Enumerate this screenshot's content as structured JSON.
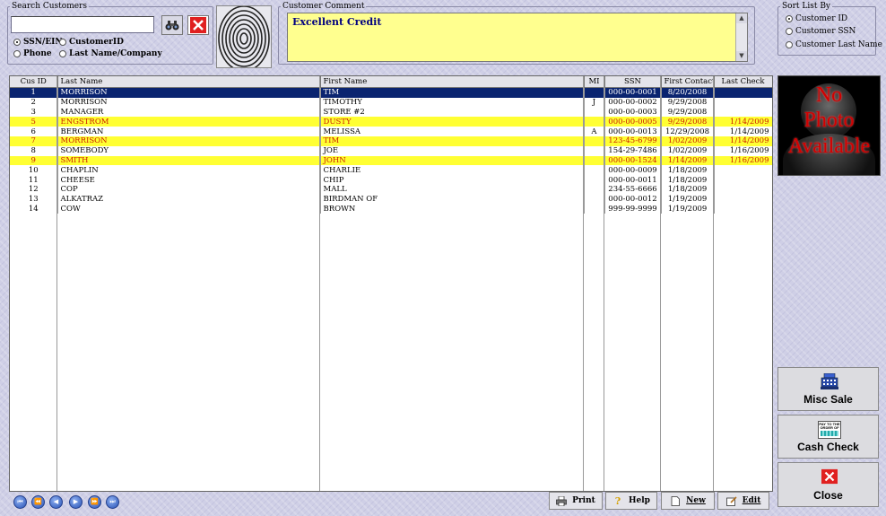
{
  "search": {
    "legend": "Search Customers",
    "value": "",
    "options": [
      {
        "label": "SSN/EIN",
        "selected": true
      },
      {
        "label": "CustomerID",
        "selected": false
      },
      {
        "label": "Phone",
        "selected": false
      },
      {
        "label": "Last Name/Company",
        "selected": false
      }
    ]
  },
  "comment": {
    "legend": "Customer Comment",
    "text": "Excellent Credit"
  },
  "sort": {
    "legend": "Sort List By",
    "options": [
      {
        "label": "Customer ID",
        "selected": true
      },
      {
        "label": "Customer SSN",
        "selected": false
      },
      {
        "label": "Customer Last Name",
        "selected": false
      }
    ]
  },
  "grid": {
    "columns": [
      "Cus ID",
      "Last Name",
      "First Name",
      "MI",
      "SSN",
      "First Contact",
      "Last Check"
    ],
    "rows": [
      {
        "id": "1",
        "last": "MORRISON",
        "first": "TIM",
        "mi": "",
        "ssn": "000-00-0001",
        "first_contact": "8/20/2008",
        "last_check": "",
        "state": "selected"
      },
      {
        "id": "2",
        "last": "MORRISON",
        "first": "TIMOTHY",
        "mi": "J",
        "ssn": "000-00-0002",
        "first_contact": "9/29/2008",
        "last_check": "",
        "state": ""
      },
      {
        "id": "3",
        "last": "MANAGER",
        "first": "STORE #2",
        "mi": "",
        "ssn": "000-00-0003",
        "first_contact": "9/29/2008",
        "last_check": "",
        "state": ""
      },
      {
        "id": "5",
        "last": "ENGSTROM",
        "first": "DUSTY",
        "mi": "",
        "ssn": "000-00-0005",
        "first_contact": "9/29/2008",
        "last_check": "1/14/2009",
        "state": "highlight"
      },
      {
        "id": "6",
        "last": "BERGMAN",
        "first": "MELISSA",
        "mi": "A",
        "ssn": "000-00-0013",
        "first_contact": "12/29/2008",
        "last_check": "1/14/2009",
        "state": ""
      },
      {
        "id": "7",
        "last": "MORRISON",
        "first": "TIM",
        "mi": "",
        "ssn": "123-45-6799",
        "first_contact": "1/02/2009",
        "last_check": "1/14/2009",
        "state": "highlight"
      },
      {
        "id": "8",
        "last": "SOMEBODY",
        "first": "JOE",
        "mi": "",
        "ssn": "154-29-7486",
        "first_contact": "1/02/2009",
        "last_check": "1/16/2009",
        "state": ""
      },
      {
        "id": "9",
        "last": "SMITH",
        "first": "JOHN",
        "mi": "",
        "ssn": "000-00-1524",
        "first_contact": "1/14/2009",
        "last_check": "1/16/2009",
        "state": "highlight"
      },
      {
        "id": "10",
        "last": "CHAPLIN",
        "first": "CHARLIE",
        "mi": "",
        "ssn": "000-00-0009",
        "first_contact": "1/18/2009",
        "last_check": "",
        "state": ""
      },
      {
        "id": "11",
        "last": "CHEESE",
        "first": "CHIP",
        "mi": "",
        "ssn": "000-00-0011",
        "first_contact": "1/18/2009",
        "last_check": "",
        "state": ""
      },
      {
        "id": "12",
        "last": "COP",
        "first": "MALL",
        "mi": "",
        "ssn": "234-55-6666",
        "first_contact": "1/18/2009",
        "last_check": "",
        "state": ""
      },
      {
        "id": "13",
        "last": "ALKATRAZ",
        "first": "BIRDMAN OF",
        "mi": "",
        "ssn": "000-00-0012",
        "first_contact": "1/19/2009",
        "last_check": "",
        "state": ""
      },
      {
        "id": "14",
        "last": "COW",
        "first": "BROWN",
        "mi": "",
        "ssn": "999-99-9999",
        "first_contact": "1/19/2009",
        "last_check": "",
        "state": ""
      }
    ]
  },
  "photo": {
    "lines": [
      "No",
      "Photo",
      "Available"
    ]
  },
  "actions": {
    "misc_sale": "Misc Sale",
    "cash_check": "Cash Check",
    "close": "Close",
    "check_icon_text": "PAY TO THE ORDER OF"
  },
  "footer": {
    "print": "Print",
    "help": "Help",
    "new": "New",
    "edit": "Edit"
  },
  "colors": {
    "selected_row": "#0a2470",
    "highlight_row": "#ffff33",
    "highlight_text": "#cc2200",
    "comment_bg": "#ffff8f"
  },
  "icons": [
    "binoculars-icon",
    "clear-icon",
    "fingerprint-icon",
    "printer-icon",
    "help-icon",
    "new-icon",
    "edit-icon",
    "cash-register-icon",
    "check-icon",
    "close-icon"
  ]
}
